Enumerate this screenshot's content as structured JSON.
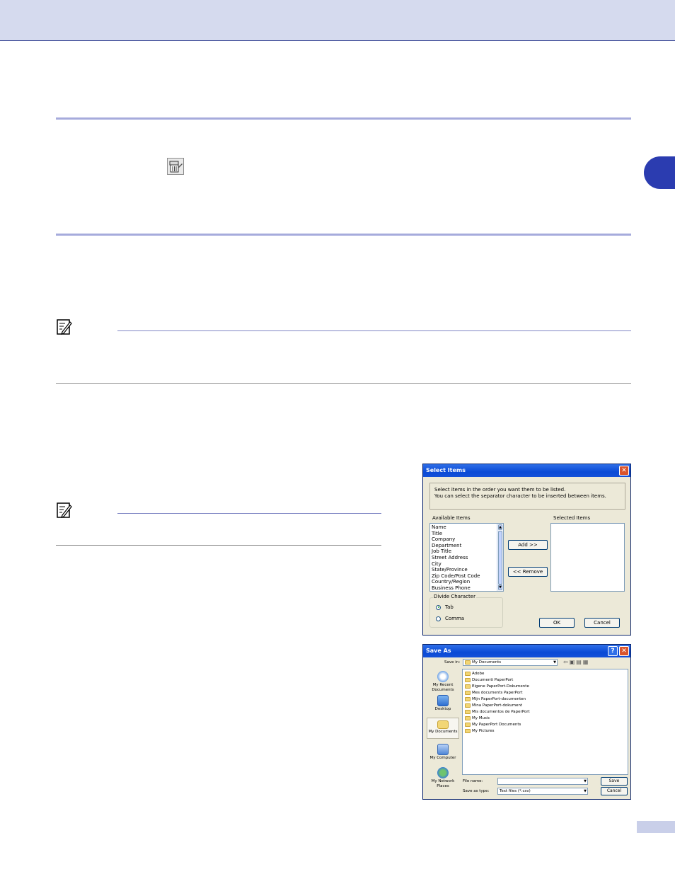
{
  "page": {
    "accent": "#2b3cb0",
    "band": "#d5daee"
  },
  "icons": {
    "note": "note-pencil-icon",
    "toolbar": "address-book-export-icon"
  },
  "select_items_dialog": {
    "title": "Select Items",
    "instructions": [
      "Select items in the order you want them to be listed.",
      "You can select the separator character to be inserted between items."
    ],
    "available_label": "Available Items",
    "selected_label": "Selected Items",
    "available_items": [
      "Name",
      "Title",
      "Company",
      "Department",
      "Job Title",
      "Street Address",
      "City",
      "State/Province",
      "Zip Code/Post Code",
      "Country/Region",
      "Business Phone"
    ],
    "add_button": "Add >>",
    "remove_button": "<< Remove",
    "divide_character_label": "Divide Character",
    "divide_options": [
      {
        "label": "Tab",
        "selected": true
      },
      {
        "label": "Comma",
        "selected": false
      }
    ],
    "ok_button": "OK",
    "cancel_button": "Cancel"
  },
  "save_as_dialog": {
    "title": "Save As",
    "save_in_label": "Save in:",
    "save_in_value": "My Documents",
    "places": [
      "My Recent Documents",
      "Desktop",
      "My Documents",
      "My Computer",
      "My Network Places"
    ],
    "files": [
      "Adobe",
      "Documenti PaperPort",
      "Eigene PaperPort-Dokumente",
      "Mes documents PaperPort",
      "Mijn PaperPort-documenten",
      "Mina PaperPort-dokument",
      "Mis documentos de PaperPort",
      "My Music",
      "My PaperPort Documents",
      "My Pictures"
    ],
    "file_name_label": "File name:",
    "file_name_value": "",
    "save_as_type_label": "Save as type:",
    "save_as_type_value": "Text files (*.csv)",
    "save_button": "Save",
    "cancel_button": "Cancel"
  }
}
